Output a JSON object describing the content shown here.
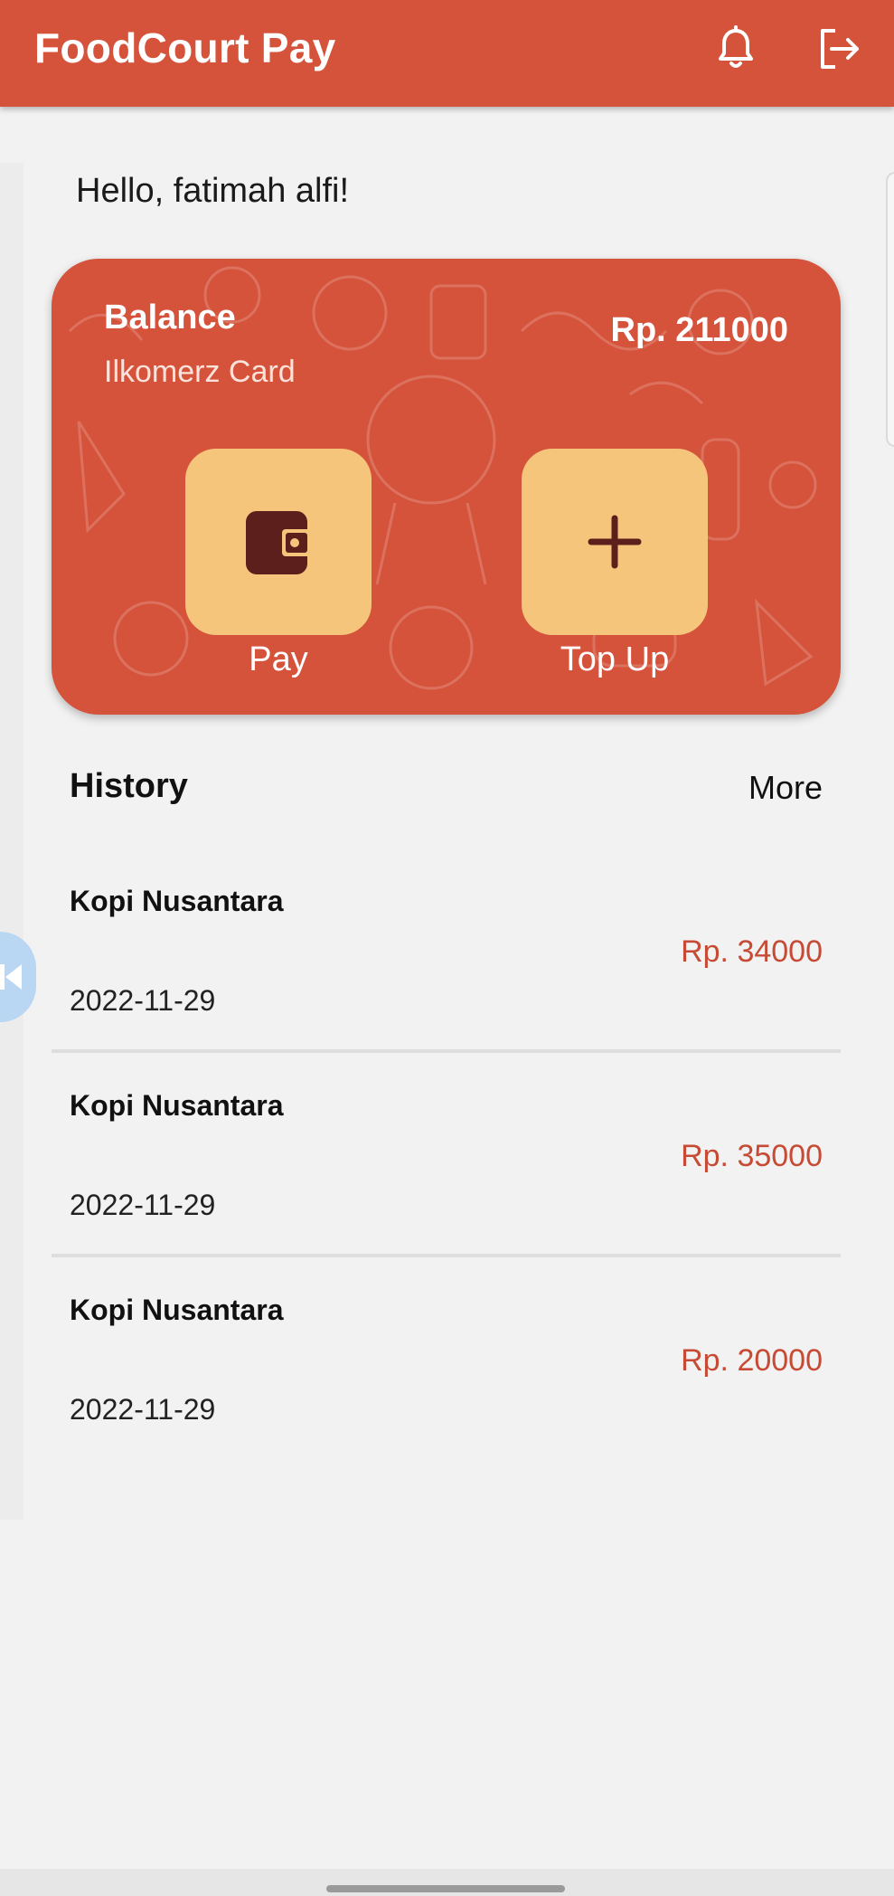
{
  "app": {
    "title": "FoodCourt Pay",
    "accent_color": "#d5523b",
    "tile_color": "#f5c57c",
    "icon_color": "#5c1f1c"
  },
  "header": {
    "icons": [
      "bell-icon",
      "logout-icon"
    ]
  },
  "greeting": "Hello, fatimah alfi!",
  "card": {
    "balance_label": "Balance",
    "card_name": "Ilkomerz Card",
    "balance_amount": "Rp. 211000",
    "actions": [
      {
        "label": "Pay",
        "icon": "wallet-icon"
      },
      {
        "label": "Top Up",
        "icon": "plus-icon"
      }
    ]
  },
  "history": {
    "title": "History",
    "more_label": "More",
    "items": [
      {
        "merchant": "Kopi Nusantara",
        "date": "2022-11-29",
        "amount": "Rp. 34000"
      },
      {
        "merchant": "Kopi Nusantara",
        "date": "2022-11-29",
        "amount": "Rp. 35000"
      },
      {
        "merchant": "Kopi Nusantara",
        "date": "2022-11-29",
        "amount": "Rp. 20000"
      }
    ]
  }
}
